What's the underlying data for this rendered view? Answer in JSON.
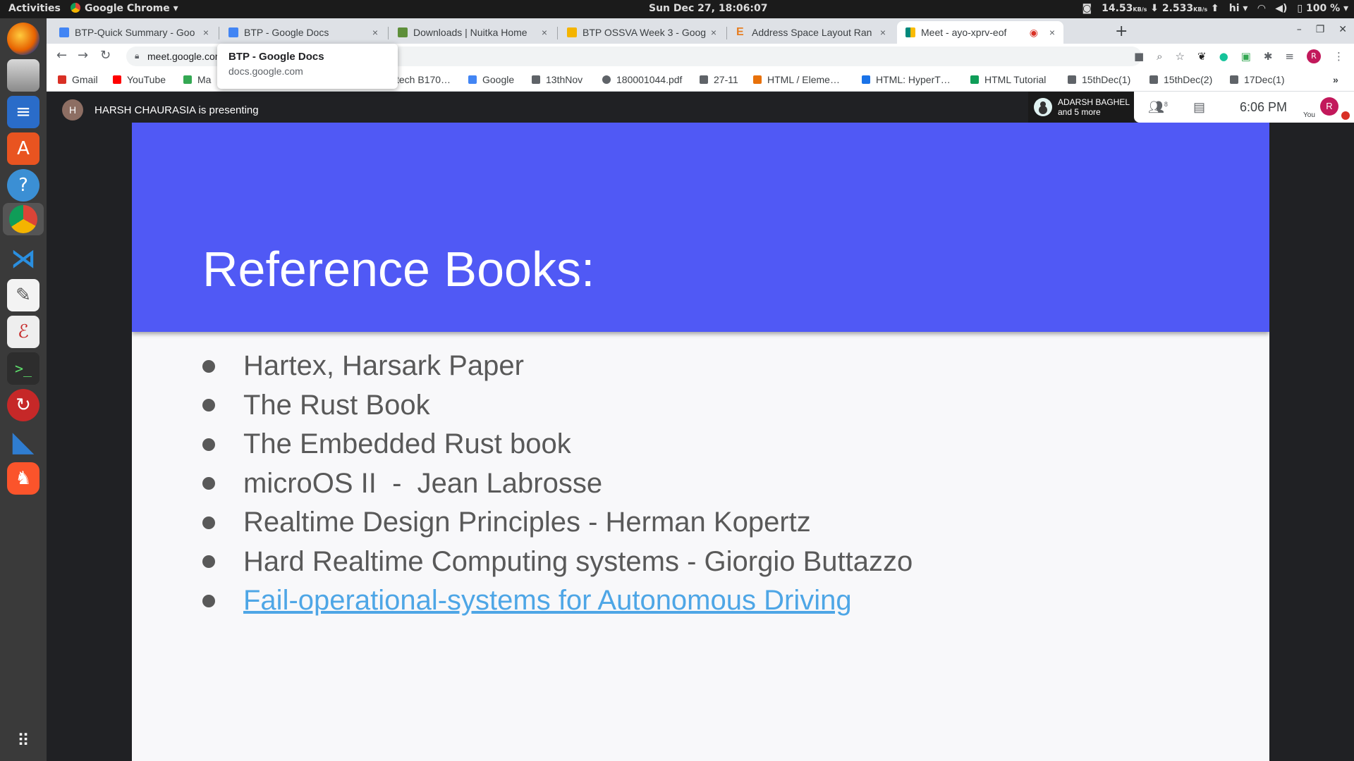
{
  "topbar": {
    "activities": "Activities",
    "app_name": "Google Chrome",
    "clock": "Sun Dec 27, 18:06:07",
    "net_down": "14.53",
    "net_down_unit": "KB/s",
    "net_up": "2.533",
    "net_up_unit": "KB/s",
    "user": "hi",
    "battery": "100 %"
  },
  "dock": {
    "items": [
      {
        "icon": "firefox-icon"
      },
      {
        "icon": "files-icon"
      },
      {
        "icon": "writer-icon"
      },
      {
        "icon": "software-center-icon"
      },
      {
        "icon": "help-icon"
      },
      {
        "icon": "chrome-icon"
      },
      {
        "icon": "vscode-icon"
      },
      {
        "icon": "text-editor-icon"
      },
      {
        "icon": "evince-icon"
      },
      {
        "icon": "terminal-icon"
      },
      {
        "icon": "remmina-icon"
      },
      {
        "icon": "wireshark-icon"
      },
      {
        "icon": "brave-icon"
      },
      {
        "icon": "app-grid-icon"
      }
    ]
  },
  "tabs": [
    {
      "label": "BTP-Quick Summary - Goo",
      "color": "#4285f4"
    },
    {
      "label": "BTP - Google Docs",
      "color": "#4285f4"
    },
    {
      "label": "Downloads | Nuitka Home",
      "color": "#5e8f3a"
    },
    {
      "label": "BTP OSSVA Week 3 - Goog",
      "color": "#f4b400"
    },
    {
      "label": "Address Space Layout Ran",
      "color": "#e67e22"
    },
    {
      "label": "Meet - ayo-xprv-eof",
      "color": "#00897b"
    }
  ],
  "omnibox": {
    "url": "meet.google.com"
  },
  "tooltip": {
    "title": "BTP - Google Docs",
    "subtitle": "docs.google.com"
  },
  "bookmarks": [
    {
      "label": "Gmail",
      "color": "#d93025"
    },
    {
      "label": "YouTube",
      "color": "#ff0000"
    },
    {
      "label": "Ma",
      "color": "#34a853"
    },
    {
      "label": "tech B170…",
      "color": "#ffffff"
    },
    {
      "label": "Google",
      "color": "#4285f4"
    },
    {
      "label": "13thNov",
      "color": "#5f6368"
    },
    {
      "label": "180001044.pdf",
      "color": "#5f6368"
    },
    {
      "label": "27-11",
      "color": "#5f6368"
    },
    {
      "label": "HTML / Eleme…",
      "color": "#e8710a"
    },
    {
      "label": "HTML: HyperT…",
      "color": "#1a73e8"
    },
    {
      "label": "HTML Tutorial",
      "color": "#0f9d58"
    },
    {
      "label": "15thDec(1)",
      "color": "#5f6368"
    },
    {
      "label": "15thDec(2)",
      "color": "#5f6368"
    },
    {
      "label": "17Dec(1)",
      "color": "#5f6368"
    }
  ],
  "meet": {
    "presenter_initial": "H",
    "presenter_text": "HARSH CHAURASIA is presenting",
    "participant_name": "ADARSH BAGHEL",
    "participant_more": "and 5 more",
    "people_count": "8",
    "time": "6:06  PM",
    "you_label": "You",
    "self_initial": "R"
  },
  "slide": {
    "title": "Reference Books:",
    "items": [
      "Hartex, Harsark Paper",
      "The Rust Book",
      "The Embedded Rust book",
      "microOS II  -  Jean Labrosse",
      "Realtime Design Principles - Herman Kopertz",
      "Hard Realtime Computing systems - Giorgio Buttazzo",
      "Fail-operational-systems for Autonomous Driving"
    ]
  }
}
